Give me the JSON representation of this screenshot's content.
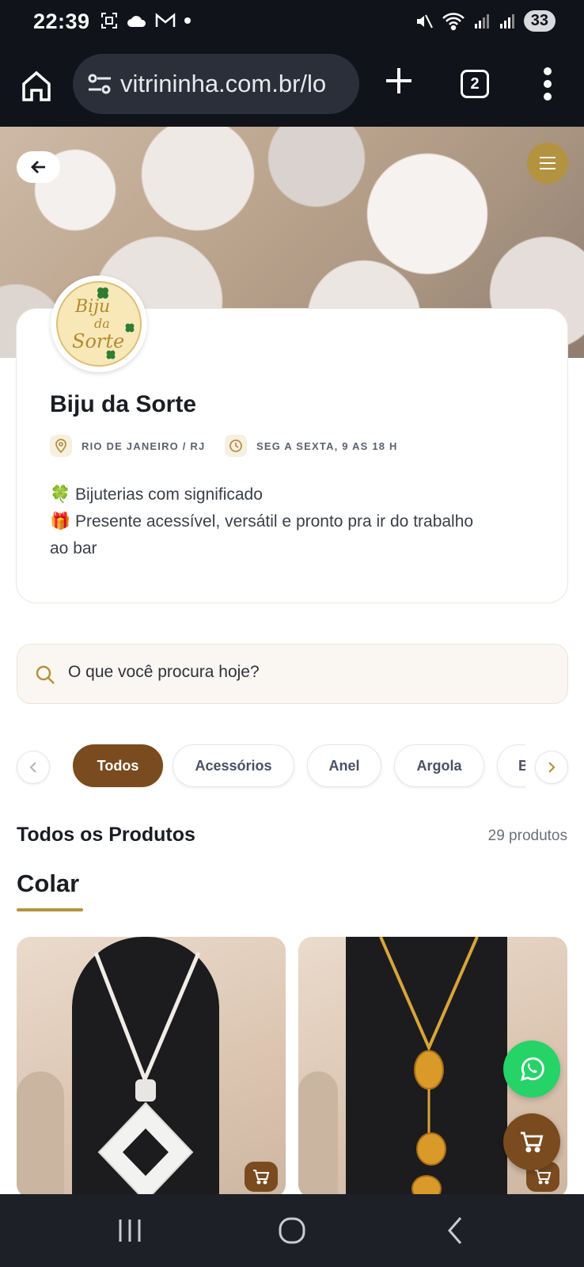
{
  "status_bar": {
    "time": "22:39",
    "battery": "33",
    "icons_left": [
      "screenshot-icon",
      "cloud-icon",
      "gmail-icon",
      "dot-icon"
    ],
    "icons_right": [
      "mute-icon",
      "wifi-icon",
      "signal-icon",
      "signal-icon"
    ]
  },
  "browser": {
    "url": "vitrininha.com.br/lo",
    "tab_count": "2"
  },
  "store": {
    "name": "Biju da Sorte",
    "logo_text": [
      "Biju",
      "da",
      "Sorte"
    ],
    "location": "RIO DE JANEIRO / RJ",
    "hours": "SEG A SEXTA, 9 AS 18 H",
    "description": [
      "🍀 Bijuterias com significado",
      "🎁 Presente acessível, versátil e pronto pra ir do trabalho",
      "ao bar"
    ]
  },
  "search": {
    "placeholder": "O que você procura hoje?"
  },
  "categories": {
    "items": [
      "Todos",
      "Acessórios",
      "Anel",
      "Argola",
      "B"
    ],
    "active": "Todos"
  },
  "products_section": {
    "title": "Todos os Produtos",
    "count": "29 produtos",
    "category_heading": "Colar"
  },
  "colors": {
    "accent_brown": "#7a4b1f",
    "accent_gold": "#b49340",
    "whatsapp_green": "#25d366"
  }
}
